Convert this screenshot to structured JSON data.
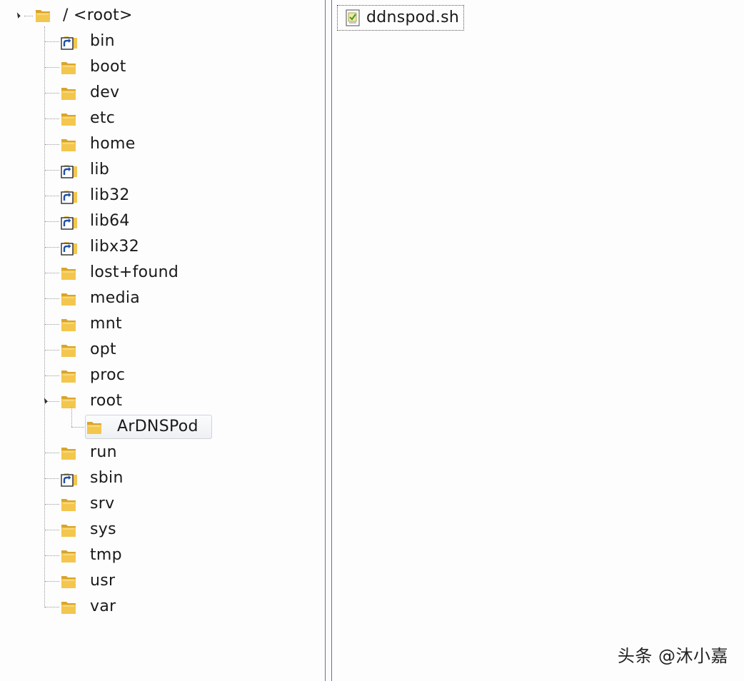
{
  "tree": {
    "root_label": "/ <root>",
    "items": [
      {
        "label": "bin",
        "type": "link"
      },
      {
        "label": "boot",
        "type": "folder"
      },
      {
        "label": "dev",
        "type": "folder"
      },
      {
        "label": "etc",
        "type": "folder"
      },
      {
        "label": "home",
        "type": "folder"
      },
      {
        "label": "lib",
        "type": "link"
      },
      {
        "label": "lib32",
        "type": "link"
      },
      {
        "label": "lib64",
        "type": "link"
      },
      {
        "label": "libx32",
        "type": "link"
      },
      {
        "label": "lost+found",
        "type": "folder"
      },
      {
        "label": "media",
        "type": "folder"
      },
      {
        "label": "mnt",
        "type": "folder"
      },
      {
        "label": "opt",
        "type": "folder"
      },
      {
        "label": "proc",
        "type": "folder"
      },
      {
        "label": "root",
        "type": "folder",
        "expanded": true
      },
      {
        "label": "ArDNSPod",
        "type": "folder",
        "child": true,
        "selected": true
      },
      {
        "label": "run",
        "type": "folder"
      },
      {
        "label": "sbin",
        "type": "link"
      },
      {
        "label": "srv",
        "type": "folder"
      },
      {
        "label": "sys",
        "type": "folder"
      },
      {
        "label": "tmp",
        "type": "folder"
      },
      {
        "label": "usr",
        "type": "folder"
      },
      {
        "label": "var",
        "type": "folder"
      }
    ]
  },
  "files": [
    {
      "label": "ddnspod.sh",
      "icon": "script-file-icon"
    }
  ],
  "watermark": "头条 @沐小嘉",
  "colors": {
    "folder": "#f3c64e",
    "folder_dark": "#d9a52a",
    "link_arrow": "#1f4fa8",
    "background": "#fdfdfe"
  }
}
